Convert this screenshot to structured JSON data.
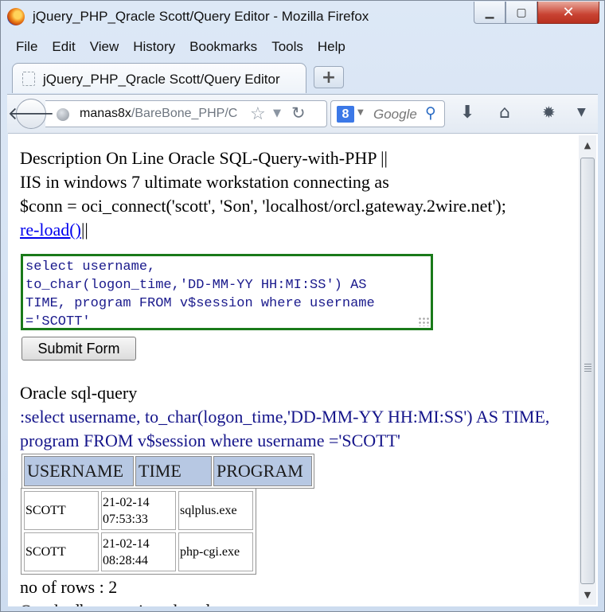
{
  "window": {
    "title": "jQuery_PHP_Qracle Scott/Query Editor - Mozilla Firefox",
    "controls": {
      "minimize": "▁",
      "maximize": "▢",
      "close": "✕"
    }
  },
  "menu": [
    "File",
    "Edit",
    "View",
    "History",
    "Bookmarks",
    "Tools",
    "Help"
  ],
  "tab": {
    "label": "jQuery_PHP_Qracle Scott/Query Editor",
    "new_tab": "+"
  },
  "nav": {
    "url_host": "manas8x",
    "url_path": "/BareBone_PHP/C",
    "search_engine_glyph": "8",
    "search_placeholder": "Google",
    "icons": {
      "back": "arrow-left",
      "star": "bookmark-star",
      "reload": "reload",
      "search": "magnifier",
      "downloads": "download-arrow",
      "home": "home",
      "addon": "bug",
      "menu": "chevron-down"
    }
  },
  "page": {
    "line1": "Description On Line Oracle SQL-Query-with-PHP ||",
    "line2": "IIS in windows 7 ultimate workstation connecting as",
    "line3": "$conn = oci_connect('scott', 'Son', 'localhost/orcl.gateway.2wire.net');",
    "reload_link": "re-load()",
    "reload_suffix": "||",
    "sql_text": "select username,\nto_char(logon_time,'DD-MM-YY HH:MI:SS') AS\nTIME, program FROM v$session where username\n='SCOTT'",
    "submit_label": "Submit Form",
    "result_label": "Oracle sql-query",
    "query_echo": ":select username, to_char(logon_time,'DD-MM-YY HH:MI:SS') AS TIME, program FROM v$session where username ='SCOTT'",
    "headers": [
      "USERNAME",
      "TIME",
      "PROGRAM"
    ],
    "rows": [
      {
        "username": "SCOTT",
        "date": "21-02-14",
        "time": "07:53:33",
        "program": "sqlplus.exe"
      },
      {
        "username": "SCOTT",
        "date": "21-02-14",
        "time": "08:28:44",
        "program": "php-cgi.exe"
      }
    ],
    "rows_count": "no of rows : 2",
    "closed": "Oracle db conection closed"
  }
}
